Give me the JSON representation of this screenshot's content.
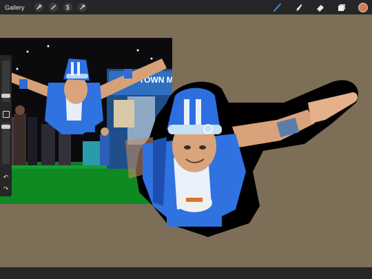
{
  "topbar": {
    "gallery_label": "Gallery",
    "left_tools": [
      "wrench-icon",
      "magic-wand-icon",
      "selection-s-icon",
      "transform-arrow-icon"
    ],
    "right_tools": [
      "brush-icon",
      "smudge-icon",
      "eraser-icon",
      "layers-icon"
    ],
    "active_color": "#d97c4f",
    "brush_accent": "#3a8ee6"
  },
  "canvas": {
    "background": "#7d6e58"
  },
  "sidebar": {
    "controls": [
      "brush-size-slider",
      "modify-button",
      "opacity-slider",
      "undo-icon",
      "redo-icon"
    ]
  }
}
